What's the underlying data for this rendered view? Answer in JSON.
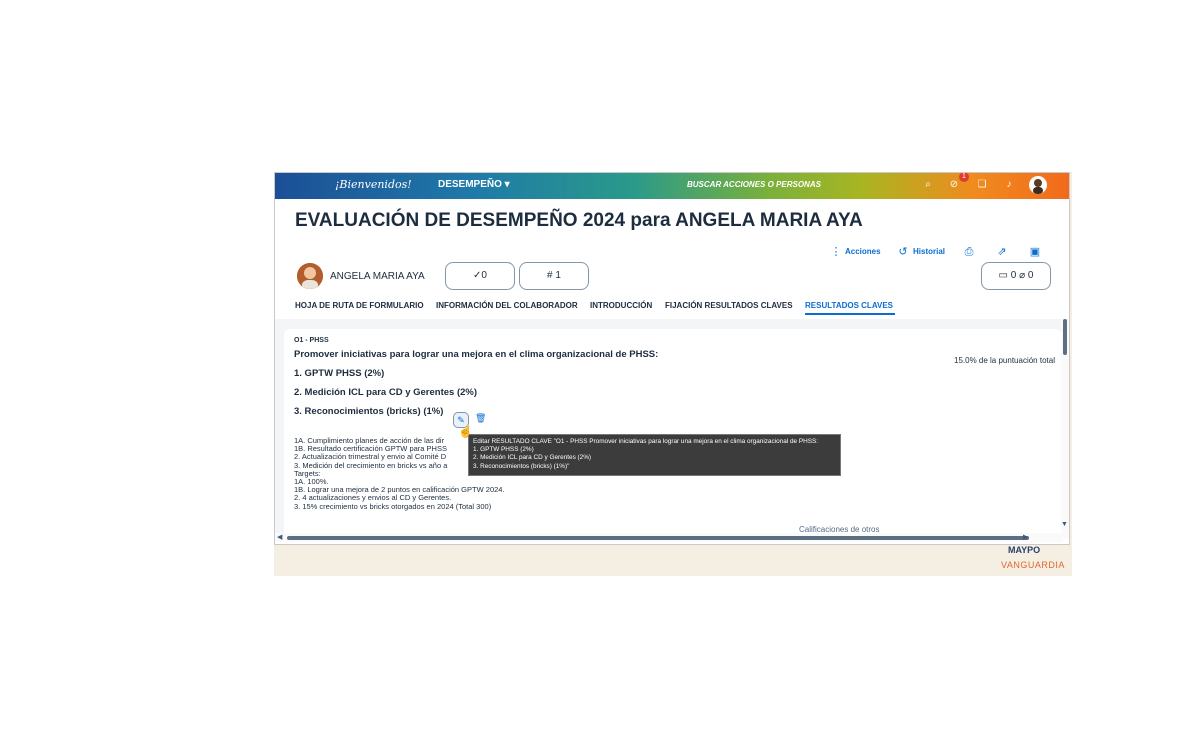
{
  "shellbar": {
    "welcome": "¡Bienvenidos!",
    "menu": "DESEMPEÑO ▾",
    "search": "BUSCAR ACCIONES O PERSONAS",
    "notification_count": "1"
  },
  "header": {
    "title": "EVALUACIÓN DE DESEMPEÑO 2024 para ANGELA MARIA AYA",
    "actions_label": "Acciones",
    "history_label": "Historial",
    "employee_name": "ANGELA MARIA AYA",
    "pill_check": "✓0",
    "pill_rank": "# 1",
    "pill_comments": "0",
    "pill_attachments": "0"
  },
  "tabs": [
    {
      "label": "HOJA DE RUTA DE FORMULARIO"
    },
    {
      "label": "INFORMACIÓN DEL COLABORADOR"
    },
    {
      "label": "INTRODUCCIÓN"
    },
    {
      "label": "FIJACIÓN RESULTADOS CLAVES"
    },
    {
      "label": "RESULTADOS CLAVES"
    }
  ],
  "objective": {
    "code": "O1 - PHSS",
    "title": "Promover iniciativas para lograr una mejora en el clima organizacional de PHSS:",
    "items": [
      "1. GPTW PHSS (2%)",
      "2. Medición ICL para CD y Gerentes (2%)",
      "3. Reconocimientos (bricks) (1%)"
    ],
    "score": "15.0% de la puntuación total",
    "description": "1A. Cumplimiento planes de acción de las dir\n1B. Resultado certificación GPTW para PHSS\n2. Actualización trimestral y envio al Comité D\n3. Medición del crecimiento en bricks vs año a\nTargets:\n1A. 100%.\n1B. Lograr una mejora de 2 puntos en calificación GPTW 2024.\n2. 4 actualizaciones y envios al CD y Gerentes.\n3. 15% crecimiento vs bricks otorgados en 2024 (Total 300)"
  },
  "tooltip": {
    "text": "Editar RESULTADO CLAVE \"O1 - PHSS Promover iniciativas para lograr una mejora en el clima organizacional de PHSS:\n1. GPTW PHSS (2%)\n2. Medición ICL para CD y Gerentes (2%)\n3. Reconocimientos (bricks) (1%)\""
  },
  "footer": {
    "others_ratings": "Calificaciones de otros",
    "logo_top": "MAYPO",
    "logo_bottom": "VANGUARDIA"
  }
}
